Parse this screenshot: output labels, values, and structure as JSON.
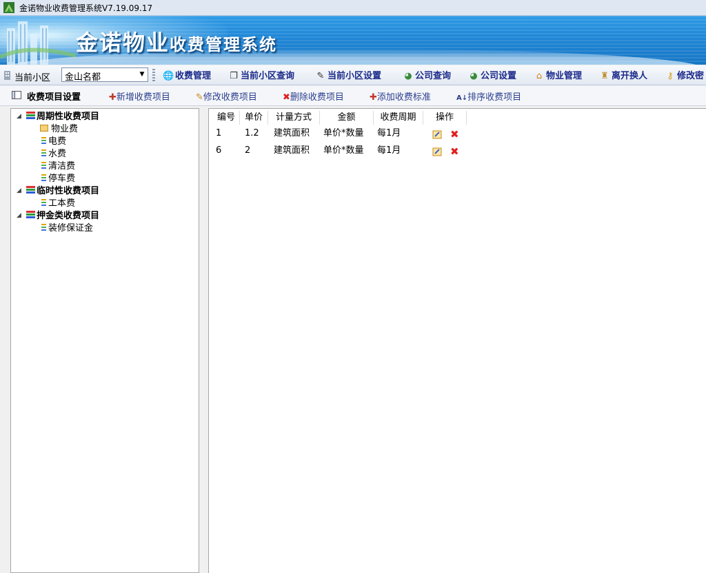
{
  "window": {
    "title": "金诺物业收费管理系统V7.19.09.17"
  },
  "banner": {
    "brand_part1": "金诺物业",
    "brand_part2": "收费管理系统"
  },
  "toolbar": {
    "community_label": "当前小区",
    "community_value": "金山名都",
    "buttons": [
      {
        "label": "收费管理",
        "icon": "globe-money-icon"
      },
      {
        "label": "当前小区查询",
        "icon": "document-icon"
      },
      {
        "label": "当前小区设置",
        "icon": "notepad-icon"
      },
      {
        "label": "公司查询",
        "icon": "globe-icon"
      },
      {
        "label": "公司设置",
        "icon": "globe-icon"
      },
      {
        "label": "物业管理",
        "icon": "house-icon"
      },
      {
        "label": "离开换人",
        "icon": "user-switch-icon"
      },
      {
        "label": "修改密",
        "icon": "key-icon"
      }
    ]
  },
  "subbar": {
    "title": "收费项目设置",
    "actions": [
      {
        "label": "新增收费项目",
        "icon": "plus-icon"
      },
      {
        "label": "修改收费项目",
        "icon": "edit-icon"
      },
      {
        "label": "删除收费项目",
        "icon": "delete-icon"
      },
      {
        "label": "添加收费标准",
        "icon": "plus-icon"
      },
      {
        "label": "排序收费项目",
        "icon": "sort-icon"
      }
    ]
  },
  "tree": {
    "groups": [
      {
        "label": "周期性收费项目",
        "items": [
          "物业费",
          "电费",
          "水费",
          "清洁费",
          "停车费"
        ],
        "selected": "物业费"
      },
      {
        "label": "临时性收费项目",
        "items": [
          "工本费"
        ]
      },
      {
        "label": "押金类收费项目",
        "items": [
          "装修保证金"
        ]
      }
    ]
  },
  "grid": {
    "columns": [
      "编号",
      "单价",
      "计量方式",
      "金额",
      "收费周期",
      "操作"
    ],
    "rows": [
      {
        "id": "1",
        "price": "1.2",
        "measure": "建筑面积",
        "amount": "单价*数量",
        "cycle": "每1月"
      },
      {
        "id": "6",
        "price": "2",
        "measure": "建筑面积",
        "amount": "单价*数量",
        "cycle": "每1月"
      }
    ]
  },
  "colors": {
    "accent": "#1b2a8a",
    "banner": "#1f86d6",
    "delete": "#e02020"
  }
}
